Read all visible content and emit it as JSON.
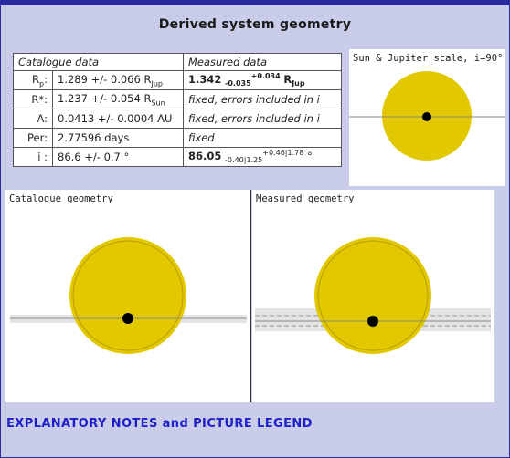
{
  "title": "Derived system geometry",
  "table": {
    "headers": {
      "catalogue": "Catalogue data",
      "measured": "Measured data"
    },
    "rows": {
      "rp": {
        "label_main": "R",
        "label_sub": "p",
        "label_colon": ":",
        "cat_value": "1.289 +/- 0.066 R",
        "cat_unit_sub": "Jup",
        "meas_value": "1.342",
        "meas_err_low": "-0.035",
        "meas_err_high": "+0.034",
        "meas_unit": "R",
        "meas_unit_sub": "Jup"
      },
      "rstar": {
        "label": "R*:",
        "cat_value": "1.237 +/- 0.054 R",
        "cat_unit_sub": "Sun",
        "meas_text": "fixed, errors included in i"
      },
      "a": {
        "label": "A:",
        "cat_value": "0.0413 +/- 0.0004 AU",
        "meas_text": "fixed, errors included in i"
      },
      "per": {
        "label": "Per:",
        "cat_value": "2.77596 days",
        "meas_text": "fixed"
      },
      "i": {
        "label": "i :",
        "cat_value": "86.6 +/- 0.7 °",
        "meas_value": "86.05",
        "meas_err_low": "-0.40|1.25",
        "meas_err_high": "+0.46|1.78",
        "meas_unit": "°"
      }
    }
  },
  "panels": {
    "sun_jupiter": "Sun & Jupiter scale, i=90°",
    "catalogue_geometry": "Catalogue geometry",
    "measured_geometry": "Measured geometry"
  },
  "notes_link": "EXPLANATORY NOTES and PICTURE LEGEND",
  "colors": {
    "star": "#e1c800",
    "star_outline": "#b89b00",
    "planet": "#000000",
    "link": "#2020c8",
    "frame": "#c9cde9",
    "border": "#2a2aa0"
  }
}
